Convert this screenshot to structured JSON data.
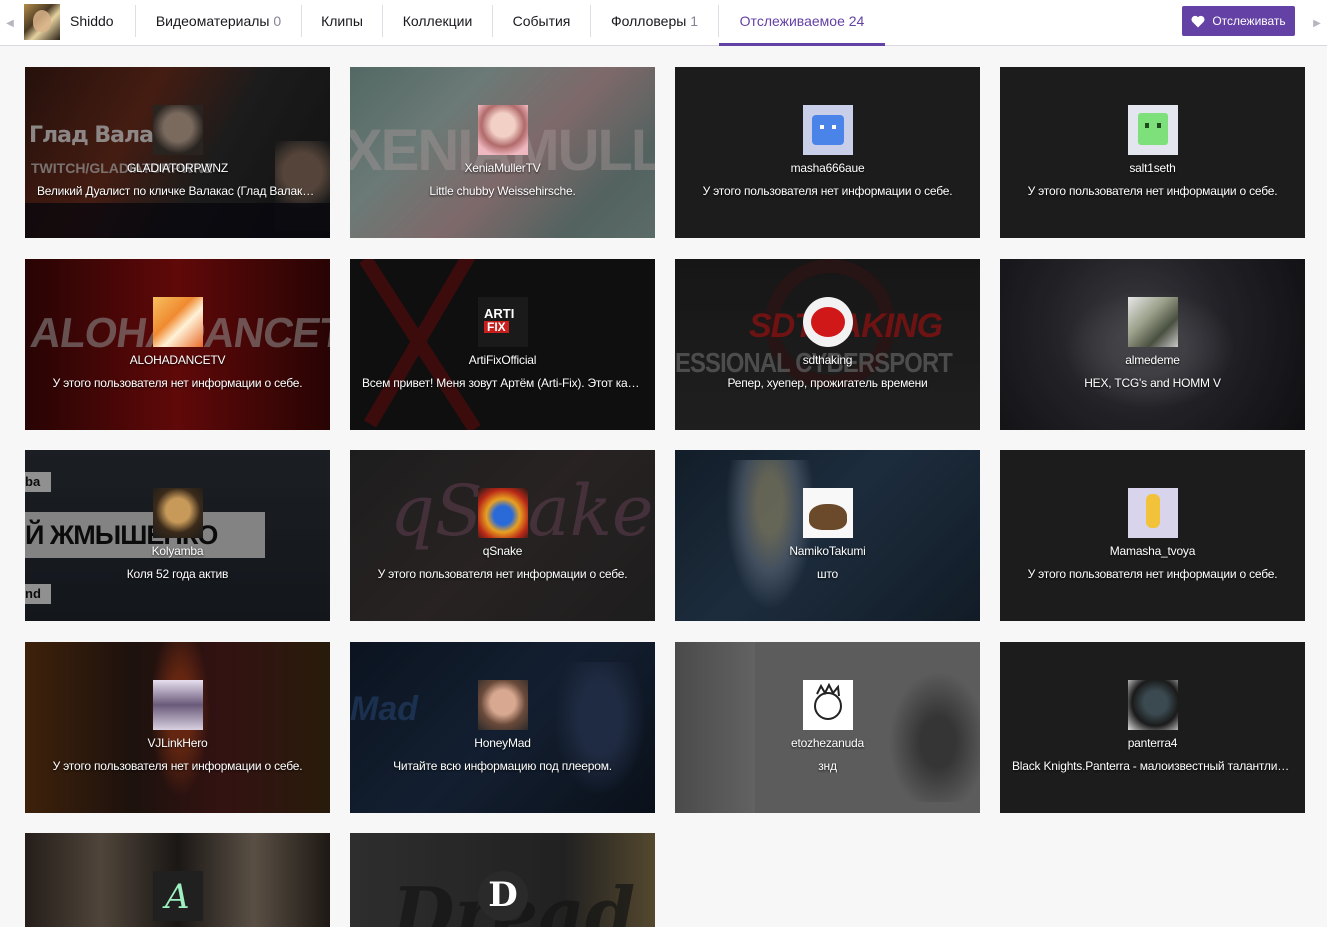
{
  "nav": {
    "username": "Shiddo",
    "tabs": [
      {
        "label": "Видеоматериалы",
        "count": "0"
      },
      {
        "label": "Клипы",
        "count": ""
      },
      {
        "label": "Коллекции",
        "count": ""
      },
      {
        "label": "События",
        "count": ""
      },
      {
        "label": "Фолловеры",
        "count": "1"
      },
      {
        "label": "Отслеживаемое",
        "count": "24"
      }
    ],
    "active_tab": "Отслеживаемое",
    "follow_button": "Отслеживать",
    "accent_color": "#6441a4"
  },
  "cards": [
    {
      "name": "GLADIATORPWNZ",
      "desc": "Великий Дуалист по кличке Валакас (Глад Валакас)"
    },
    {
      "name": "XeniaMullerTV",
      "desc": "Little chubby Weissehirsche."
    },
    {
      "name": "masha666aue",
      "desc": "У этого пользователя нет информации о себе."
    },
    {
      "name": "salt1seth",
      "desc": "У этого пользователя нет информации о себе."
    },
    {
      "name": "ALOHADANCETV",
      "desc": "У этого пользователя нет информации о себе."
    },
    {
      "name": "ArtiFixOfficial",
      "desc": "Всем привет! Меня зовут Артём (Arti-Fix). Этот канал"
    },
    {
      "name": "sdthaking",
      "desc": "Репер, хуепер, прожигатель времени"
    },
    {
      "name": "almedeme",
      "desc": "HEX, TCG's and HOMM V"
    },
    {
      "name": "Kolyamba",
      "desc": "Коля 52 года актив"
    },
    {
      "name": "qSnake",
      "desc": "У этого пользователя нет информации о себе."
    },
    {
      "name": "NamikoTakumi",
      "desc": "што"
    },
    {
      "name": "Mamasha_tvoya",
      "desc": "У этого пользователя нет информации о себе."
    },
    {
      "name": "VJLinkHero",
      "desc": "У этого пользователя нет информации о себе."
    },
    {
      "name": "HoneyMad",
      "desc": "Читайте всю информацию под плеером."
    },
    {
      "name": "etozhezanuda",
      "desc": "знд"
    },
    {
      "name": "panterra4",
      "desc": "Black Knights.Panterra - малоизвестный талантливый"
    },
    {
      "name": "",
      "desc": ""
    },
    {
      "name": "",
      "desc": ""
    }
  ],
  "banner_text": {
    "gladiator_title": "Глад Валакас",
    "gladiator_sub": "TWITCH/GLADIATORPWNZ",
    "xenia": "XENIAMULLERTV",
    "aloha": "ALOHADANCETV",
    "artifix_logo_top": "ARTI",
    "artifix_logo_bottom": "FIX",
    "sdt_top": "SDTHAKING",
    "sdt_bottom": "ESSIONAL CYBERSPORT",
    "kolyamba_big": "Й ЖМЫШЕНКО",
    "kolyamba_top": "ba",
    "kolyamba_bottom": "nd",
    "qsnake": "qSnake",
    "honeymad": "Mad",
    "dread": "Dread",
    "dread_letter": "D"
  }
}
